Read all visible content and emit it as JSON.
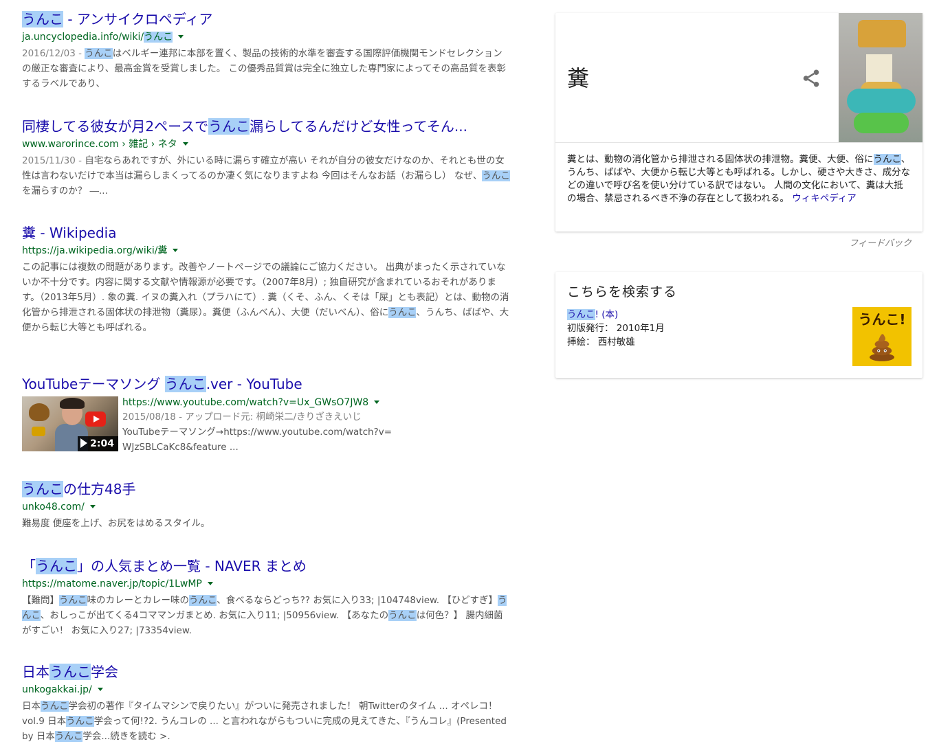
{
  "results": [
    {
      "title_parts": [
        {
          "t": "うんこ",
          "hl": true
        },
        {
          "t": " - アンサイクロペディア",
          "hl": false
        }
      ],
      "url_parts": [
        {
          "t": "ja.uncyclopedia.info/wiki/",
          "hl": false
        },
        {
          "t": "うんこ",
          "hl": true
        }
      ],
      "snippet_parts": [
        {
          "t": "2016/12/03 - ",
          "date": true
        },
        {
          "t": "うんこ",
          "hl": true
        },
        {
          "t": "はベルギー連邦に本部を置く、製品の技術的水準を審査する国際評価機関モンドセレクションの厳正な審査により、最高金賞を受賞しました。 この優秀品質賞は完全に独立した専門家によってその高品質を表彰するラベルであり、"
        }
      ]
    },
    {
      "title_parts": [
        {
          "t": "同棲してる彼女が月2ペースで",
          "hl": false
        },
        {
          "t": "うんこ",
          "hl": true
        },
        {
          "t": "漏らしてるんだけど女性ってそん...",
          "hl": false
        }
      ],
      "url_parts": [
        {
          "t": "www.warorince.com › 雑記 › ネタ",
          "hl": false
        }
      ],
      "snippet_parts": [
        {
          "t": "2015/11/30 - ",
          "date": true
        },
        {
          "t": "自宅ならあれですが、外にいる時に漏らす確立が高い それが自分の彼女だけなのか、それとも世の女性は言わないだけで本当は漏らしまくってるのか凄く気になりますよね 今回はそんなお話（お漏らし） なぜ、"
        },
        {
          "t": "うんこ",
          "hl": true
        },
        {
          "t": "を漏らすのか？ ―..."
        }
      ]
    },
    {
      "title_parts": [
        {
          "t": "糞 - Wikipedia",
          "hl": false
        }
      ],
      "url_parts": [
        {
          "t": "https://ja.wikipedia.org/wiki/糞",
          "hl": false
        }
      ],
      "snippet_parts": [
        {
          "t": "この記事には複数の問題があります。改善やノートページでの議論にご協力ください。 出典がまったく示されていないか不十分です。内容に関する文献や情報源が必要です。（2007年8月）; 独自研究が含まれているおそれがあります。（2013年5月）. 象の糞. イヌの糞入れ（プラハにて）. 糞（くそ、ふん、くそは「屎」とも表記）とは、動物の消化管から排泄される固体状の排泄物（糞尿）。糞便（ふんべん）、大便（だいべん）、俗に"
        },
        {
          "t": "うんこ",
          "hl": true
        },
        {
          "t": "、うんち、ばばや、大便から転じ大等とも呼ばれる。"
        }
      ]
    },
    {
      "title_parts": [
        {
          "t": "YouTubeテーマソング ",
          "hl": false
        },
        {
          "t": "うんこ",
          "hl": true
        },
        {
          "t": ".ver - YouTube",
          "hl": false
        }
      ],
      "url_parts": [
        {
          "t": "https://www.youtube.com/watch?v=Ux_GWsO7JW8",
          "hl": false
        }
      ],
      "video": {
        "duration": "2:04",
        "lines": [
          "2015/08/18 - アップロード元: 桐崎栄二/きりざきえいじ",
          "YouTubeテーマソング→https://www.youtube.com/watch?v=",
          "WJzSBLCaKc8&feature ..."
        ]
      }
    },
    {
      "title_parts": [
        {
          "t": "うんこ",
          "hl": true
        },
        {
          "t": "の仕方48手",
          "hl": false
        }
      ],
      "url_parts": [
        {
          "t": "unko48.com/",
          "hl": false
        }
      ],
      "snippet_parts": [
        {
          "t": "難易度 便座を上げ、お尻をはめるスタイル。"
        }
      ]
    },
    {
      "title_parts": [
        {
          "t": "「",
          "hl": false
        },
        {
          "t": "うんこ",
          "hl": true
        },
        {
          "t": "」の人気まとめ一覧 - NAVER まとめ",
          "hl": false
        }
      ],
      "url_parts": [
        {
          "t": "https://matome.naver.jp/topic/1LwMP",
          "hl": false
        }
      ],
      "snippet_parts": [
        {
          "t": "【難問】"
        },
        {
          "t": "うんこ",
          "hl": true
        },
        {
          "t": "味のカレーとカレー味の"
        },
        {
          "t": "うんこ",
          "hl": true
        },
        {
          "t": "、食べるならどっち?? お気に入り33; |104748view. 【ひどすぎ】"
        },
        {
          "t": "うんこ",
          "hl": true
        },
        {
          "t": "、おしっこが出てくる4コママンガまとめ. お気に入り11; |50956view. 【あなたの"
        },
        {
          "t": "うんこ",
          "hl": true
        },
        {
          "t": "は何色？】 腸内細菌がすごい！ お気に入り27; |73354view."
        }
      ]
    },
    {
      "title_parts": [
        {
          "t": "日本",
          "hl": false
        },
        {
          "t": "うんこ",
          "hl": true
        },
        {
          "t": "学会",
          "hl": false
        }
      ],
      "url_parts": [
        {
          "t": "unkogakkai.jp/",
          "hl": false
        }
      ],
      "snippet_parts": [
        {
          "t": "日本"
        },
        {
          "t": "うんこ",
          "hl": true
        },
        {
          "t": "学会初の著作『タイムマシンで戻りたい』がついに発売されました！ 朝Twitterのタイム ... オペレコ！ vol.9 日本"
        },
        {
          "t": "うんこ",
          "hl": true
        },
        {
          "t": "学会って何!?2. うんコレの ... と言われながらもついに完成の見えてきた、『うんコレ』(Presented by 日本"
        },
        {
          "t": "うんこ",
          "hl": true
        },
        {
          "t": "学会...続きを読む >."
        }
      ]
    }
  ],
  "knowledge_panel": {
    "title": "糞",
    "share_icon": "share-icon",
    "desc_parts": [
      {
        "t": "糞とは、動物の消化管から排泄される固体状の排泄物。糞便、大便、俗に"
      },
      {
        "t": "うんこ",
        "hl": true
      },
      {
        "t": "、うんち、ばばや、大便から転じ大等とも呼ばれる。しかし、硬さや大きさ、成分などの違いで呼び名を使い分けている訳ではない。 人間の文化において、糞は大抵の場合、禁忌されるべき不浄の存在として扱われる。 "
      }
    ],
    "source_link": "ウィキペディア",
    "feedback": "フィードバック"
  },
  "search_panel": {
    "title": "こちらを検索する",
    "book_hl": "うんこ",
    "book_rest": "! (本)",
    "first_pub_label": "初版発行：",
    "first_pub_value": "2010年1月",
    "illustrator_label": "挿絵：",
    "illustrator_value": "西村敏雄",
    "cover_text": "うんこ!"
  },
  "colors": {
    "link": "#1a0dab",
    "url": "#006621",
    "highlight": "#a8d0f7",
    "snippet": "#545454"
  }
}
